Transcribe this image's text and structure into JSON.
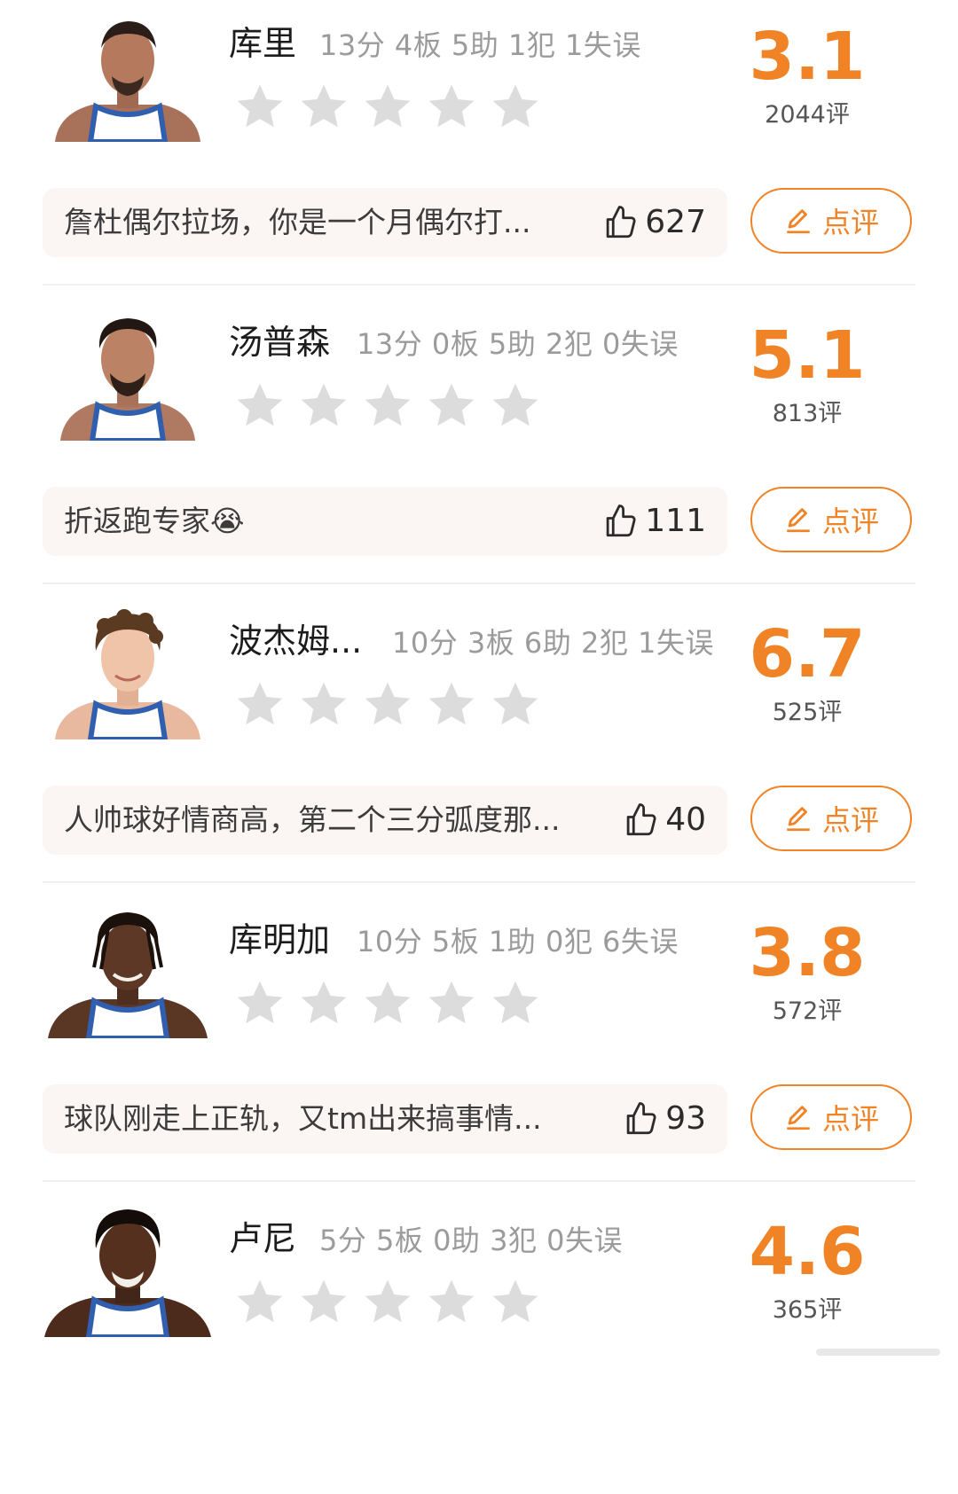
{
  "rating_button_label": "点评",
  "players": [
    {
      "name": "库里",
      "stats": "13分 4板 5助 1犯 1失误",
      "score": "3.1",
      "reviews": "2044评",
      "top_comment": "詹杜偶尔拉场，你是一个月偶尔打...",
      "likes": "627",
      "star_rating": 0
    },
    {
      "name": "汤普森",
      "stats": "13分 0板 5助 2犯 0失误",
      "score": "5.1",
      "reviews": "813评",
      "top_comment": "折返跑专家",
      "comment_emoji": "😭",
      "likes": "111",
      "star_rating": 0
    },
    {
      "name": "波杰姆...",
      "stats": "10分 3板 6助 2犯 1失误",
      "score": "6.7",
      "reviews": "525评",
      "top_comment": "人帅球好情商高，第二个三分弧度那...",
      "likes": "40",
      "star_rating": 0
    },
    {
      "name": "库明加",
      "stats": "10分 5板 1助 0犯 6失误",
      "score": "3.8",
      "reviews": "572评",
      "top_comment": "球队刚走上正轨，又tm出来搞事情...",
      "likes": "93",
      "star_rating": 0
    },
    {
      "name": "卢尼",
      "stats": "5分 5板 0助 3犯 0失误",
      "score": "4.6",
      "reviews": "365评",
      "star_rating": 0
    }
  ],
  "colors": {
    "accent": "#f08326",
    "star_empty": "#dcdcdc",
    "comment_bg": "#fbf6f3",
    "jersey": "#ffffff",
    "jersey_trim": "#2f5fae"
  },
  "icons": {
    "like": "thumbs-up-icon",
    "rate": "pencil-edit-icon",
    "star": "star-icon"
  }
}
